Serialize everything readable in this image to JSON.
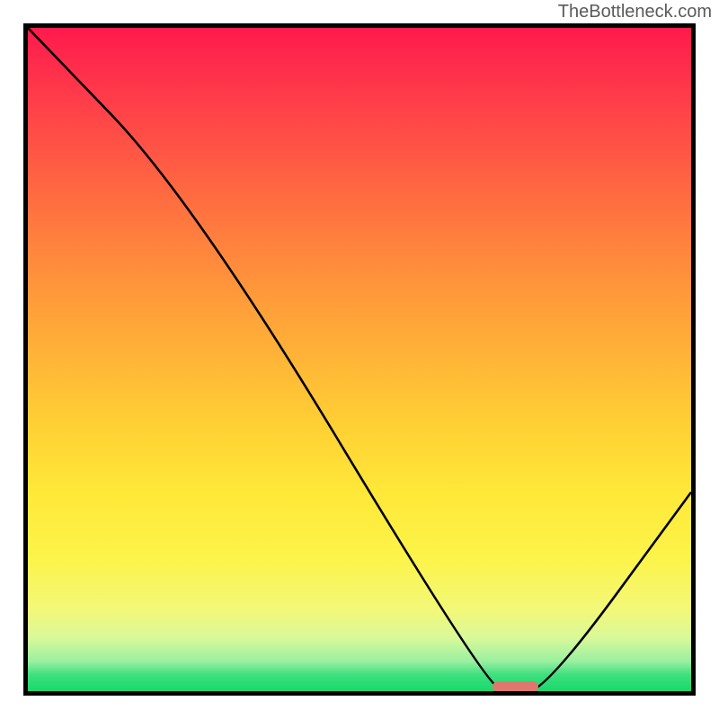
{
  "watermark": "TheBottleneck.com",
  "chart_data": {
    "type": "line",
    "title": "",
    "xlabel": "",
    "ylabel": "",
    "xlim": [
      0,
      100
    ],
    "ylim": [
      0,
      100
    ],
    "series": [
      {
        "name": "bottleneck-curve",
        "x": [
          0,
          25,
          69,
          73,
          78,
          100
        ],
        "y": [
          100,
          74,
          1,
          0,
          0,
          30
        ]
      }
    ],
    "annotations": [
      {
        "name": "optimal-marker",
        "x_start": 70,
        "x_end": 77,
        "y": 0
      }
    ],
    "gradient_stops": [
      {
        "pos": 0,
        "color": "#ff1a4d"
      },
      {
        "pos": 0.5,
        "color": "#ffb537"
      },
      {
        "pos": 0.8,
        "color": "#fcf44a"
      },
      {
        "pos": 1.0,
        "color": "#18d86b"
      }
    ]
  }
}
